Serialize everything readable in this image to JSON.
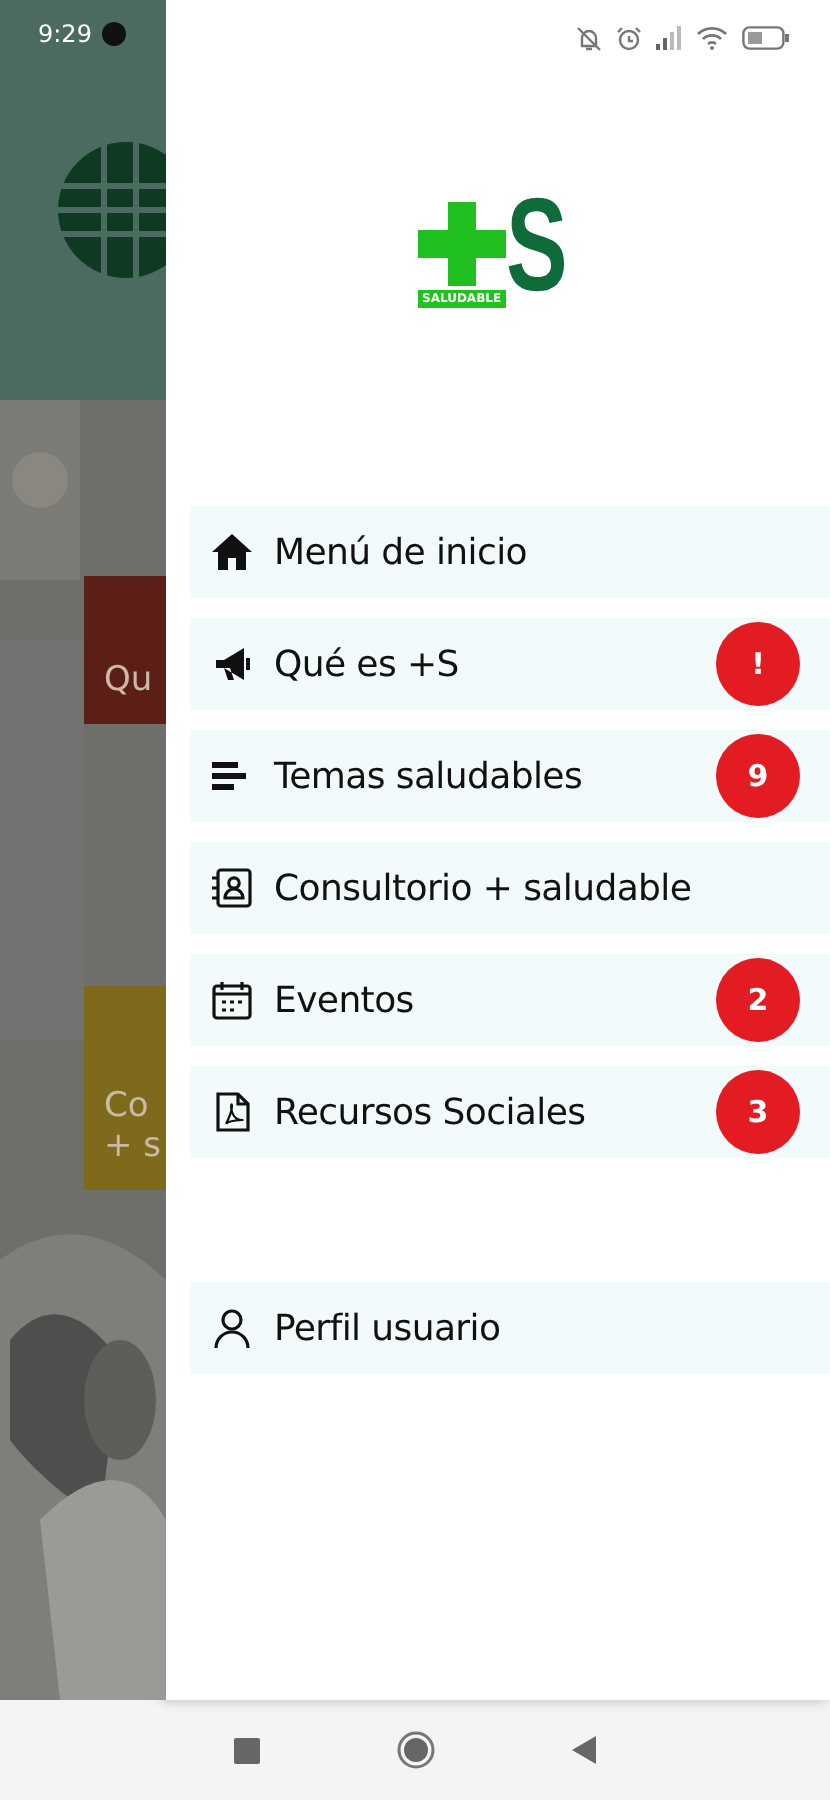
{
  "status_bar": {
    "time": "9:29"
  },
  "background": {
    "cards": [
      {
        "lines": [
          "Qu"
        ],
        "color": "#5b1f17"
      },
      {
        "lines": [
          "Co",
          "+ s"
        ],
        "color": "#7f6a1c"
      }
    ]
  },
  "drawer": {
    "logo": {
      "letter": "S",
      "label": "SALUDABLE"
    },
    "items": [
      {
        "label": "Menú de inicio"
      },
      {
        "label": "Qué es +S",
        "badge": "!"
      },
      {
        "label": "Temas saludables",
        "badge": "9"
      },
      {
        "label": "Consultorio + saludable"
      },
      {
        "label": "Eventos",
        "badge": "2"
      },
      {
        "label": "Recursos Sociales",
        "badge": "3"
      }
    ],
    "footer_items": [
      {
        "label": "Perfil usuario"
      }
    ]
  }
}
